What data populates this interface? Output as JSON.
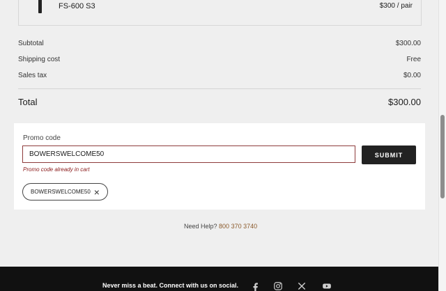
{
  "product": {
    "name": "FS-600 S3",
    "price": "$300 / pair"
  },
  "summary": [
    {
      "label": "Subtotal",
      "value": "$300.00"
    },
    {
      "label": "Shipping cost",
      "value": "Free"
    },
    {
      "label": "Sales tax",
      "value": "$0.00"
    }
  ],
  "total": {
    "label": "Total",
    "value": "$300.00"
  },
  "promo": {
    "label": "Promo code",
    "input_value": "BOWERSWELCOME50",
    "submit_label": "SUBMIT",
    "error": "Promo code already in cart",
    "applied_code": "BOWERSWELCOME50"
  },
  "help": {
    "prefix": "Need Help?",
    "phone": "800 370 3740"
  },
  "footer": {
    "text": "Never miss a beat. Connect with us on social.",
    "icons": [
      "facebook-icon",
      "instagram-icon",
      "x-icon",
      "youtube-icon"
    ]
  },
  "colors": {
    "accent": "#8b5a2b",
    "error": "#8b1c1c",
    "button": "#222222"
  }
}
